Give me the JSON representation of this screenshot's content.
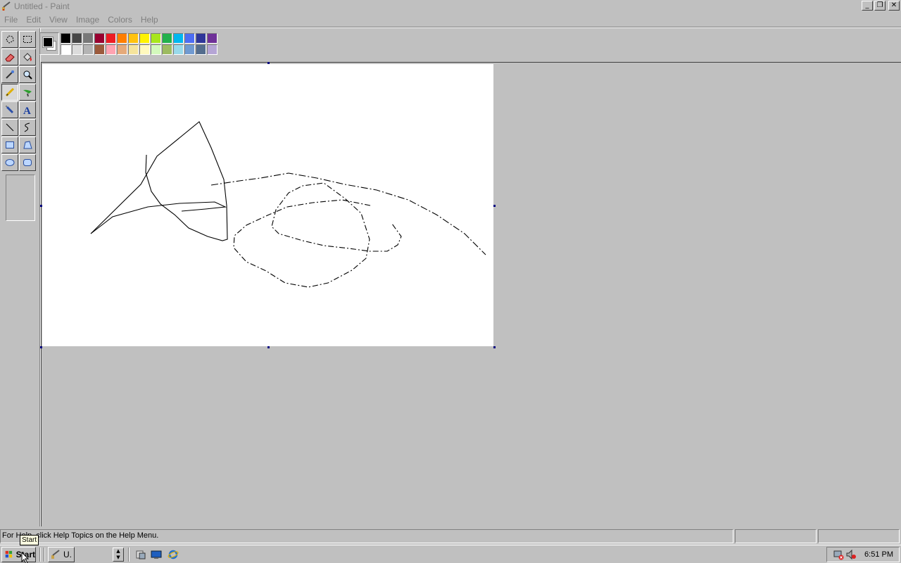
{
  "window": {
    "title": "Untitled - Paint",
    "controls": [
      "minimize",
      "restore",
      "close"
    ]
  },
  "menu": [
    "File",
    "Edit",
    "View",
    "Image",
    "Colors",
    "Help"
  ],
  "tools": [
    {
      "name": "free-form-select",
      "active": false
    },
    {
      "name": "select",
      "active": false
    },
    {
      "name": "eraser",
      "active": false
    },
    {
      "name": "fill-with-color",
      "active": false
    },
    {
      "name": "pick-color",
      "active": false
    },
    {
      "name": "magnifier",
      "active": false
    },
    {
      "name": "pencil",
      "active": true
    },
    {
      "name": "brush",
      "active": false
    },
    {
      "name": "airbrush",
      "active": false
    },
    {
      "name": "text",
      "active": false
    },
    {
      "name": "line",
      "active": false
    },
    {
      "name": "curve",
      "active": false
    },
    {
      "name": "rectangle",
      "active": false
    },
    {
      "name": "polygon",
      "active": false
    },
    {
      "name": "ellipse",
      "active": false
    },
    {
      "name": "rounded-rectangle",
      "active": false
    }
  ],
  "palette": {
    "foreground": "#000000",
    "background": "#ffffff",
    "row1": [
      "#000000",
      "#464646",
      "#787878",
      "#990030",
      "#ed1c24",
      "#ff7e00",
      "#ffc20e",
      "#fff200",
      "#a8e61d",
      "#22b14c",
      "#00b7ef",
      "#4d6df3",
      "#2f3699",
      "#6f3198"
    ],
    "row2": [
      "#ffffff",
      "#dcdcdc",
      "#b4b4b4",
      "#9c5a3c",
      "#ffa3b1",
      "#e5aa7a",
      "#f5e49c",
      "#fff9bd",
      "#d3f9bc",
      "#9dbb61",
      "#99d9ea",
      "#709ad1",
      "#546d8e",
      "#b5a5d5"
    ]
  },
  "status": {
    "help_text": "For Help, click Help Topics on the Help Menu.",
    "coords": "",
    "size": ""
  },
  "taskbar": {
    "start_label": "Start",
    "task_label": "U.",
    "clock": "6:51 PM",
    "tooltip": "Start"
  }
}
